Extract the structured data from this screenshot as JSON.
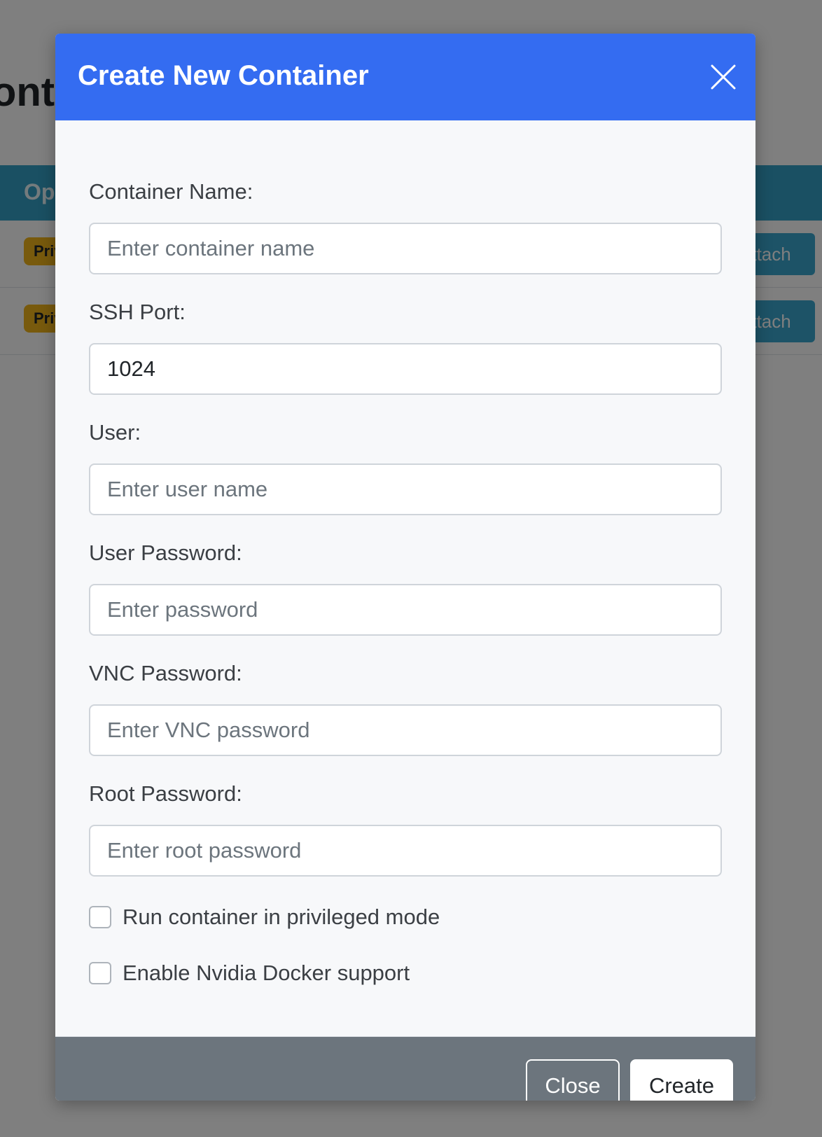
{
  "background": {
    "page_title": "Containers",
    "table_header_text": "Operations",
    "rows": [
      {
        "badge": "Privileged",
        "action": "Attach"
      },
      {
        "badge": "Privileged",
        "action": "Attach"
      }
    ]
  },
  "modal": {
    "title": "Create New Container",
    "close_icon": "close-icon",
    "fields": [
      {
        "label": "Container Name:",
        "value": "",
        "placeholder": "Enter container name"
      },
      {
        "label": "SSH Port:",
        "value": "1024",
        "placeholder": ""
      },
      {
        "label": "User:",
        "value": "",
        "placeholder": "Enter user name"
      },
      {
        "label": "User Password:",
        "value": "",
        "placeholder": "Enter password"
      },
      {
        "label": "VNC Password:",
        "value": "",
        "placeholder": "Enter VNC password"
      },
      {
        "label": "Root Password:",
        "value": "",
        "placeholder": "Enter root password"
      }
    ],
    "checkboxes": [
      {
        "label": "Run container in privileged mode",
        "checked": false
      },
      {
        "label": "Enable Nvidia Docker support",
        "checked": false
      }
    ],
    "footer": {
      "close_label": "Close",
      "create_label": "Create"
    }
  },
  "colors": {
    "modal_header": "#346cf1",
    "table_header": "#35a0c6",
    "badge": "#f0b51b",
    "footer": "#6c757d"
  }
}
